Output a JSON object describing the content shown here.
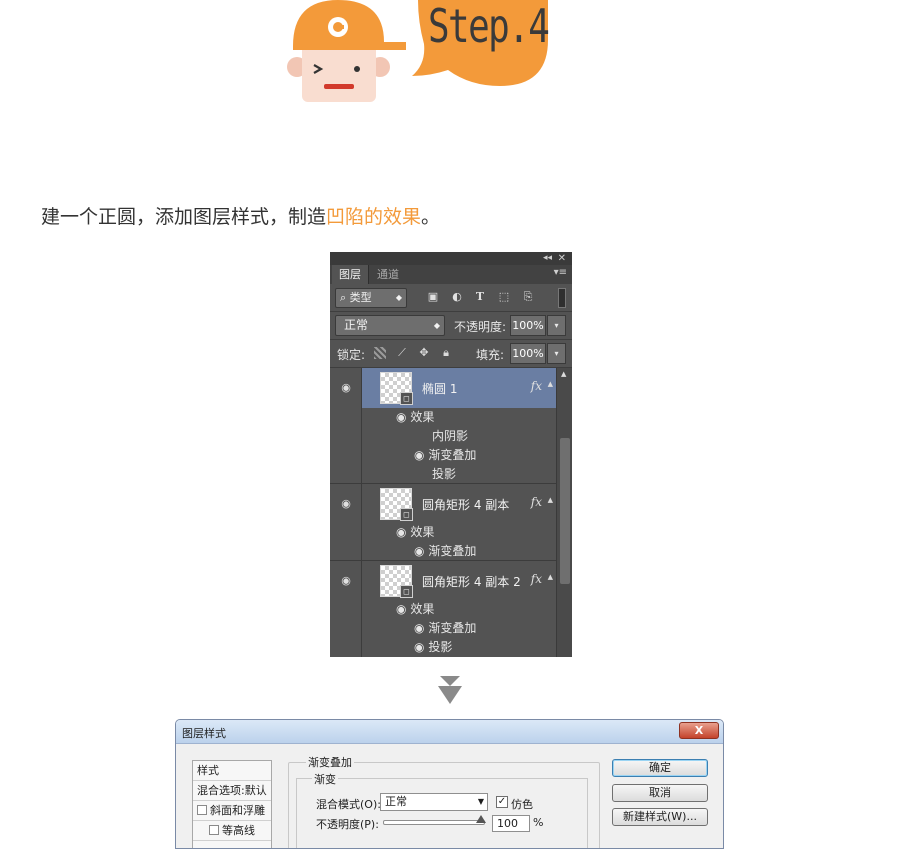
{
  "header": {
    "step_label": "Step.4"
  },
  "instruction": {
    "prefix": "建一个正圆，添加图层样式，制造",
    "highlight": "凹陷的效果",
    "suffix": "。"
  },
  "layers_panel": {
    "tabs": [
      {
        "label": "图层",
        "active": true
      },
      {
        "label": "通道",
        "active": false
      }
    ],
    "filter": {
      "kind_label": "类型",
      "icons": [
        "image-filter-icon",
        "adjustment-filter-icon",
        "type-filter-icon",
        "shape-filter-icon",
        "smart-object-filter-icon"
      ]
    },
    "blend_mode": "正常",
    "opacity_label": "不透明度:",
    "opacity_value": "100%",
    "lock_label": "锁定:",
    "fill_label": "填充:",
    "fill_value": "100%",
    "layers": [
      {
        "name": "椭圆 1",
        "selected": true,
        "has_fx": true,
        "effects_label": "效果",
        "effects": [
          {
            "label": "内阴影",
            "visible": false
          },
          {
            "label": "渐变叠加",
            "visible": true
          },
          {
            "label": "投影",
            "visible": false
          }
        ]
      },
      {
        "name": "圆角矩形 4 副本",
        "selected": false,
        "has_fx": true,
        "effects_label": "效果",
        "effects": [
          {
            "label": "渐变叠加",
            "visible": true
          }
        ]
      },
      {
        "name": "圆角矩形 4 副本 2",
        "selected": false,
        "has_fx": true,
        "effects_label": "效果",
        "effects": [
          {
            "label": "渐变叠加",
            "visible": true
          },
          {
            "label": "投影",
            "visible": true
          }
        ]
      }
    ],
    "fx_label": "fx"
  },
  "style_dialog": {
    "title": "图层样式",
    "close_label": "X",
    "style_list": [
      {
        "label": "样式",
        "checkbox": false
      },
      {
        "label": "混合选项:默认",
        "checkbox": false
      },
      {
        "label": "斜面和浮雕",
        "checkbox": true
      },
      {
        "label": "等高线",
        "checkbox": true
      }
    ],
    "group_title": "渐变叠加",
    "subgroup_title": "渐变",
    "blend_mode_label": "混合模式(O):",
    "blend_mode_value": "正常",
    "dither_label": "仿色",
    "dither_checked": true,
    "opacity_label": "不透明度(P):",
    "opacity_value": "100",
    "opacity_unit": "%",
    "buttons": {
      "ok": "确定",
      "cancel": "取消",
      "new_style": "新建样式(W)..."
    }
  },
  "colors": {
    "accent_orange": "#f39a3a",
    "panel_bg": "#535353",
    "selected_layer": "#6a7ea3"
  }
}
